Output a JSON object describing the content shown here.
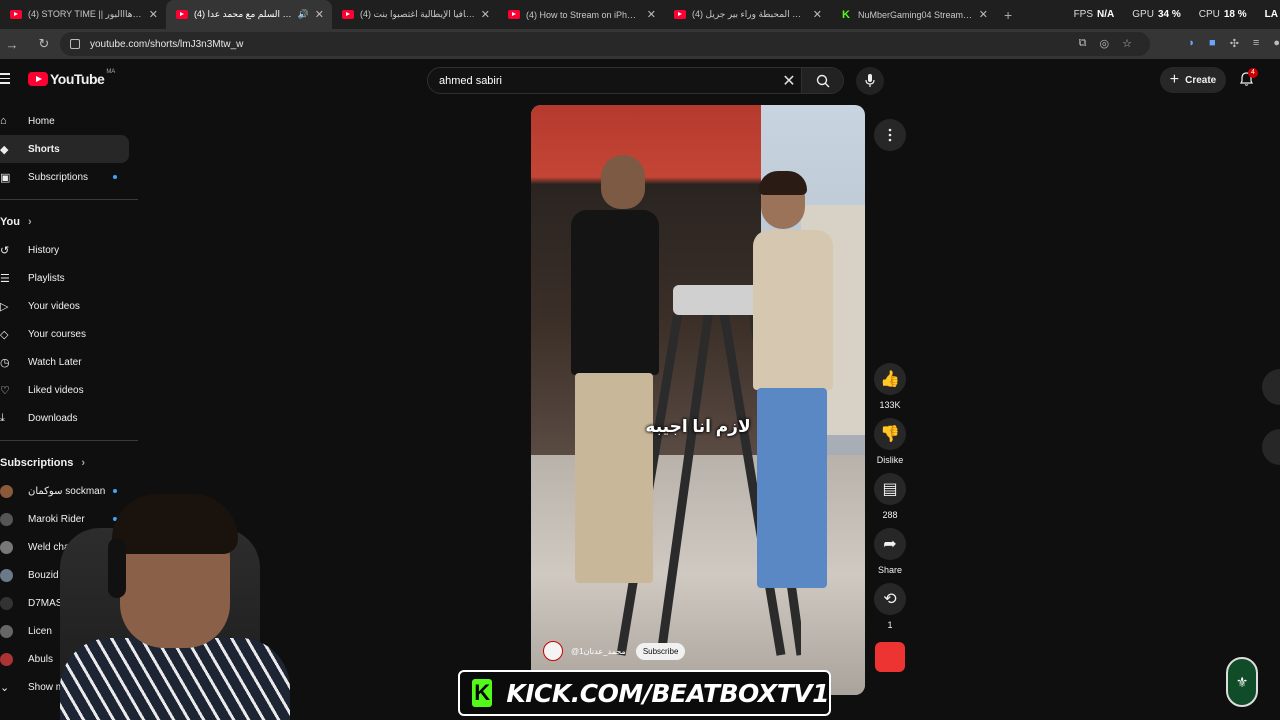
{
  "browser": {
    "tabs": [
      {
        "label": "(4) STORY TIME || وروبا و هااالبور",
        "type": "yt",
        "active": false
      },
      {
        "label": "(4) تحدي السلم مع محمد عدا",
        "type": "yt",
        "active": true
      },
      {
        "label": "(4) المافيا الإيطالية اغتصبوا بنت",
        "type": "yt",
        "active": false
      },
      {
        "label": "(4) How to Stream on iPhone w",
        "type": "yt",
        "active": false
      },
      {
        "label": "(4) الحقائق المحبطة وراء بير جريل",
        "type": "yt",
        "active": false
      },
      {
        "label": "NuMberGaming04 Stream - W",
        "type": "kick",
        "active": false
      }
    ],
    "stats": [
      {
        "key": "FPS",
        "value": "N/A"
      },
      {
        "key": "GPU",
        "value": "34 %"
      },
      {
        "key": "CPU",
        "value": "18 %"
      },
      {
        "key": "",
        "value": "LA"
      }
    ],
    "url": "youtube.com/shorts/lmJ3n3Mtw_w"
  },
  "youtube": {
    "logo_text": "YouTube",
    "country": "MA",
    "search_query": "ahmed sabiri",
    "create_label": "Create",
    "notification_count": "4",
    "nav": [
      {
        "label": "Home",
        "icon": "home-icon"
      },
      {
        "label": "Shorts",
        "icon": "shorts-icon",
        "active": true
      },
      {
        "label": "Subscriptions",
        "icon": "subscriptions-icon",
        "dot": true
      }
    ],
    "you_heading": "You",
    "you_items": [
      {
        "label": "History",
        "icon": "history-icon"
      },
      {
        "label": "Playlists",
        "icon": "playlists-icon"
      },
      {
        "label": "Your videos",
        "icon": "your-videos-icon"
      },
      {
        "label": "Your courses",
        "icon": "courses-icon"
      },
      {
        "label": "Watch Later",
        "icon": "clock-icon"
      },
      {
        "label": "Liked videos",
        "icon": "like-icon"
      },
      {
        "label": "Downloads",
        "icon": "download-icon"
      }
    ],
    "subscriptions_heading": "Subscriptions",
    "subscriptions": [
      {
        "label": "سوكمان sockman",
        "dot": true
      },
      {
        "label": "Maroki Rider",
        "dot": true
      },
      {
        "label": "Weld char9i",
        "dot": false
      },
      {
        "label": "Bouzid Vlogs",
        "dot": false
      },
      {
        "label": "D7MAS",
        "dot": false
      },
      {
        "label": "Licen",
        "dot": false
      },
      {
        "label": "Abuls",
        "dot": false
      },
      {
        "label": "Show m",
        "dot": false
      }
    ],
    "short": {
      "subtitle": "لازم انا اجيبه",
      "channel": "@محمد_عدنان1",
      "subscribe_label": "Subscribe"
    },
    "actions": [
      {
        "icon": "thumbs-up-icon",
        "label": "133K"
      },
      {
        "icon": "thumbs-down-icon",
        "label": "Dislike"
      },
      {
        "icon": "comment-icon",
        "label": "288"
      },
      {
        "icon": "share-icon",
        "label": "Share"
      },
      {
        "icon": "remix-icon",
        "label": "1"
      }
    ]
  },
  "overlay": {
    "kick_text": "KICK.COM/BEATBOXTV1",
    "kick_logo": "K"
  }
}
